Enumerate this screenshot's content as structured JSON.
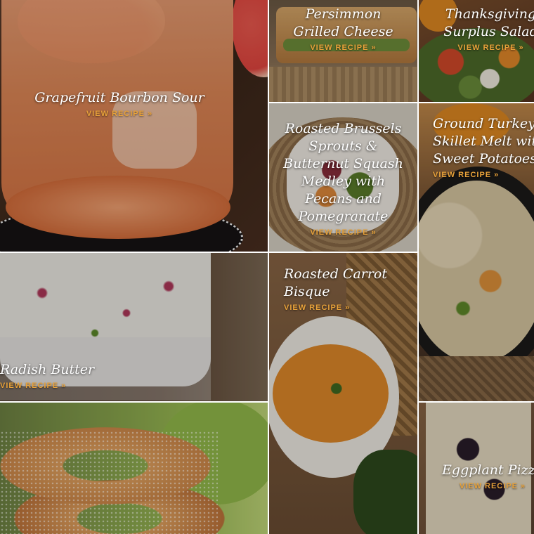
{
  "recipes": [
    {
      "title": "Grapefruit Bourbon Sour",
      "link": "VIEW RECIPE »"
    },
    {
      "title": "Persimmon\nGrilled Cheese",
      "link": "VIEW RECIPE »"
    },
    {
      "title": "Thanksgiving\nSurplus Salad",
      "link": "VIEW RECIPE »"
    },
    {
      "title": "Roasted Brussels\nSprouts &\nButternut Squash\nMedley with\nPecans and\nPomegranate",
      "link": "VIEW RECIPE »"
    },
    {
      "title": "Ground Turkey\nSkillet Melt with\nSweet Potatoes",
      "link": "VIEW RECIPE »"
    },
    {
      "title": "Radish Butter",
      "link": "VIEW RECIPE »"
    },
    {
      "title": "Roasted Carrot\nBisque",
      "link": "VIEW RECIPE »"
    },
    {
      "title": "",
      "link": ""
    },
    {
      "title": "Eggplant Pizza",
      "link": "VIEW RECIPE »"
    }
  ],
  "colors": {
    "link_accent": "#e8a23a",
    "title_text": "#ffffff",
    "gutter": "#ffffff"
  }
}
